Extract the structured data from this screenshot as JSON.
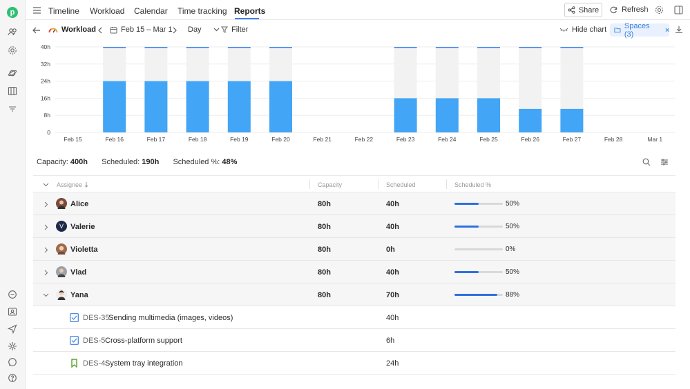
{
  "nav": {
    "tabs": [
      "Timeline",
      "Workload",
      "Calendar",
      "Time tracking",
      "Reports"
    ],
    "active_tab": "Reports",
    "share_label": "Share",
    "refresh_label": "Refresh"
  },
  "subbar": {
    "report_label": "Workload",
    "date_range": "Feb 15 – Mar 1",
    "granularity": "Day",
    "filter_label": "Filter",
    "hide_chart_label": "Hide chart",
    "spaces_label": "Spaces (3)"
  },
  "chart_data": {
    "type": "bar",
    "categories": [
      "Feb 15",
      "Feb 16",
      "Feb 17",
      "Feb 18",
      "Feb 19",
      "Feb 20",
      "Feb 21",
      "Feb 22",
      "Feb 23",
      "Feb 24",
      "Feb 25",
      "Feb 26",
      "Feb 27",
      "Feb 28",
      "Mar 1"
    ],
    "series": [
      {
        "name": "Capacity",
        "values": [
          0,
          40,
          40,
          40,
          40,
          40,
          0,
          0,
          40,
          40,
          40,
          40,
          40,
          0,
          0
        ]
      },
      {
        "name": "Scheduled",
        "values": [
          0,
          24,
          24,
          24,
          24,
          24,
          0,
          0,
          16,
          16,
          16,
          11,
          11,
          0,
          0
        ]
      }
    ],
    "y_ticks": [
      "0",
      "8h",
      "16h",
      "24h",
      "32h",
      "40h"
    ],
    "ylim": [
      0,
      40
    ],
    "colors": {
      "capacity": "#f2f2f2",
      "scheduled": "#42a5f5",
      "capacity_top": "#3b82f6"
    }
  },
  "summary": {
    "capacity_label": "Capacity:",
    "capacity_value": "400h",
    "scheduled_label": "Scheduled:",
    "scheduled_value": "190h",
    "pct_label": "Scheduled %:",
    "pct_value": "48%"
  },
  "table": {
    "headers": [
      "Assignee",
      "Capacity",
      "Scheduled",
      "Scheduled %"
    ],
    "rows": [
      {
        "name": "Alice",
        "capacity": "80h",
        "scheduled": "40h",
        "pct": "50%",
        "fill": 0.5,
        "expanded": false
      },
      {
        "name": "Valerie",
        "capacity": "80h",
        "scheduled": "40h",
        "pct": "50%",
        "fill": 0.5,
        "expanded": false,
        "initial": "V"
      },
      {
        "name": "Violetta",
        "capacity": "80h",
        "scheduled": "0h",
        "pct": "0%",
        "fill": 0,
        "expanded": false
      },
      {
        "name": "Vlad",
        "capacity": "80h",
        "scheduled": "40h",
        "pct": "50%",
        "fill": 0.5,
        "expanded": false
      },
      {
        "name": "Yana",
        "capacity": "80h",
        "scheduled": "70h",
        "pct": "88%",
        "fill": 0.88,
        "expanded": true
      }
    ],
    "subrows": [
      {
        "key": "DES-35",
        "title": "Sending multimedia (images, videos)",
        "scheduled": "40h",
        "type": "task"
      },
      {
        "key": "DES-5",
        "title": "Cross-platform support",
        "scheduled": "6h",
        "type": "task"
      },
      {
        "key": "DES-4",
        "title": "System tray integration",
        "scheduled": "24h",
        "type": "story"
      }
    ]
  }
}
